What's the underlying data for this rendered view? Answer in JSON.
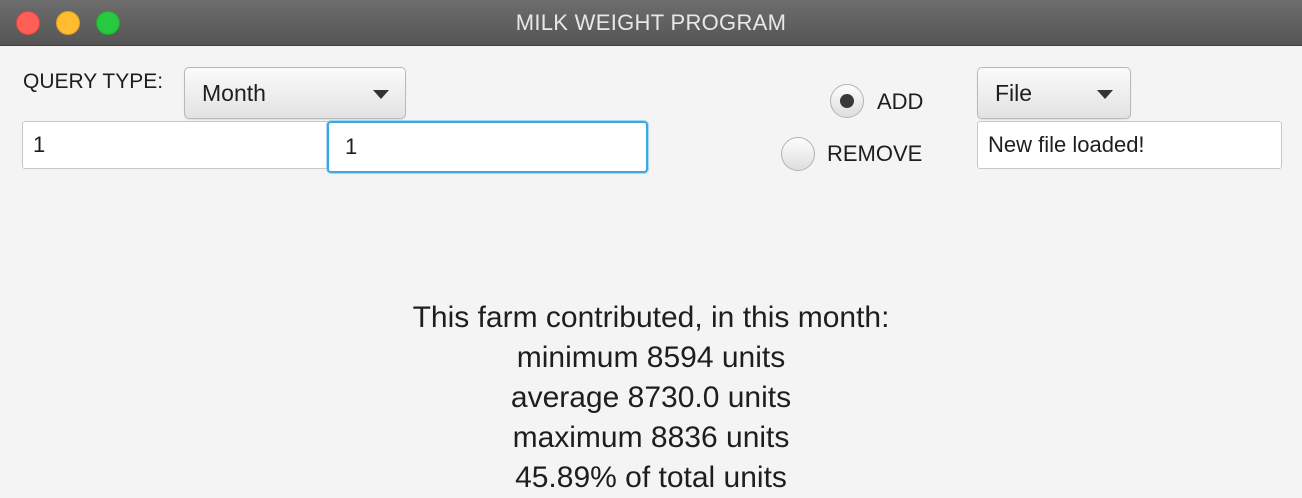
{
  "window": {
    "title": "MILK WEIGHT PROGRAM"
  },
  "query": {
    "label": "QUERY TYPE:",
    "type_selected": "Month",
    "input1_value": "1",
    "input2_value": "1"
  },
  "mode": {
    "add_label": "ADD",
    "remove_label": "REMOVE",
    "selected": "ADD"
  },
  "source": {
    "selected": "File",
    "status_value": "New file loaded!"
  },
  "results": {
    "line1": "This farm contributed, in this month:",
    "line2": "minimum 8594 units",
    "line3": "average 8730.0 units",
    "line4": "maximum 8836 units",
    "line5": "45.89% of total units"
  },
  "colors": {
    "titlebar": "#5f5f5f",
    "window_bg": "#f4f4f4",
    "focus_ring": "#3ba8e0",
    "close": "#fe5f57",
    "minimize": "#febc2e",
    "maximize": "#28c840"
  }
}
